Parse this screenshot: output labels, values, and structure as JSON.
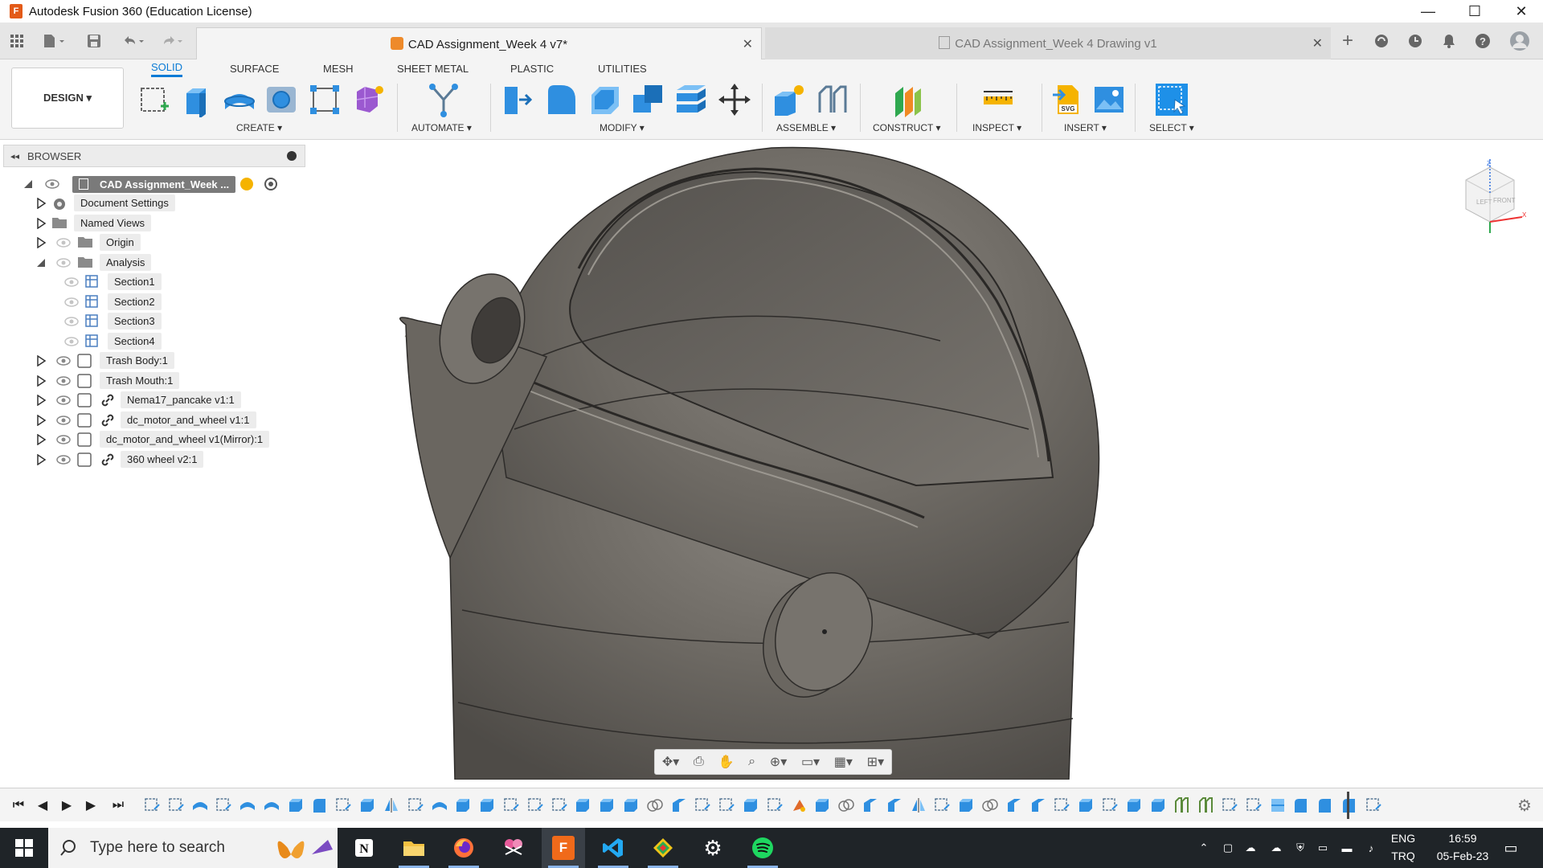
{
  "window": {
    "title": "Autodesk Fusion 360 (Education License)",
    "minimize": "—",
    "maximize": "☐",
    "close": "✕"
  },
  "tabs": {
    "active": {
      "title": "CAD Assignment_Week 4 v7*",
      "close": "✕"
    },
    "inactive": {
      "title": "CAD Assignment_Week 4 Drawing v1",
      "close": "✕"
    },
    "new_tab": "+"
  },
  "workspace": {
    "label": "DESIGN ▾"
  },
  "ribbon_tabs": [
    "SOLID",
    "SURFACE",
    "MESH",
    "SHEET METAL",
    "PLASTIC",
    "UTILITIES"
  ],
  "groups": {
    "create": "CREATE ▾",
    "automate": "AUTOMATE ▾",
    "modify": "MODIFY ▾",
    "assemble": "ASSEMBLE ▾",
    "construct": "CONSTRUCT ▾",
    "inspect": "INSPECT ▾",
    "insert": "INSERT ▾",
    "select": "SELECT ▾"
  },
  "browser": {
    "title": "BROWSER",
    "root": "CAD Assignment_Week ...",
    "items": [
      "Document Settings",
      "Named Views",
      "Origin",
      "Analysis",
      "Section1",
      "Section2",
      "Section3",
      "Section4",
      "Trash Body:1",
      "Trash Mouth:1",
      "Nema17_pancake v1:1",
      "dc_motor_and_wheel v1:1",
      "dc_motor_and_wheel v1(Mirror):1",
      "360 wheel v2:1"
    ]
  },
  "viewcube": {
    "left": "LEFT",
    "front": "FRONT",
    "z": "Z",
    "x": "X"
  },
  "taskbar": {
    "search_placeholder": "Type here to search",
    "lang_top": "ENG",
    "lang_bottom": "TRQ",
    "time": "16:59",
    "date": "05-Feb-23",
    "fusion_badge": "F"
  },
  "colors": {
    "accent": "#0a7bd6",
    "model": "#6e6a64",
    "taskbar": "#1f2428"
  }
}
